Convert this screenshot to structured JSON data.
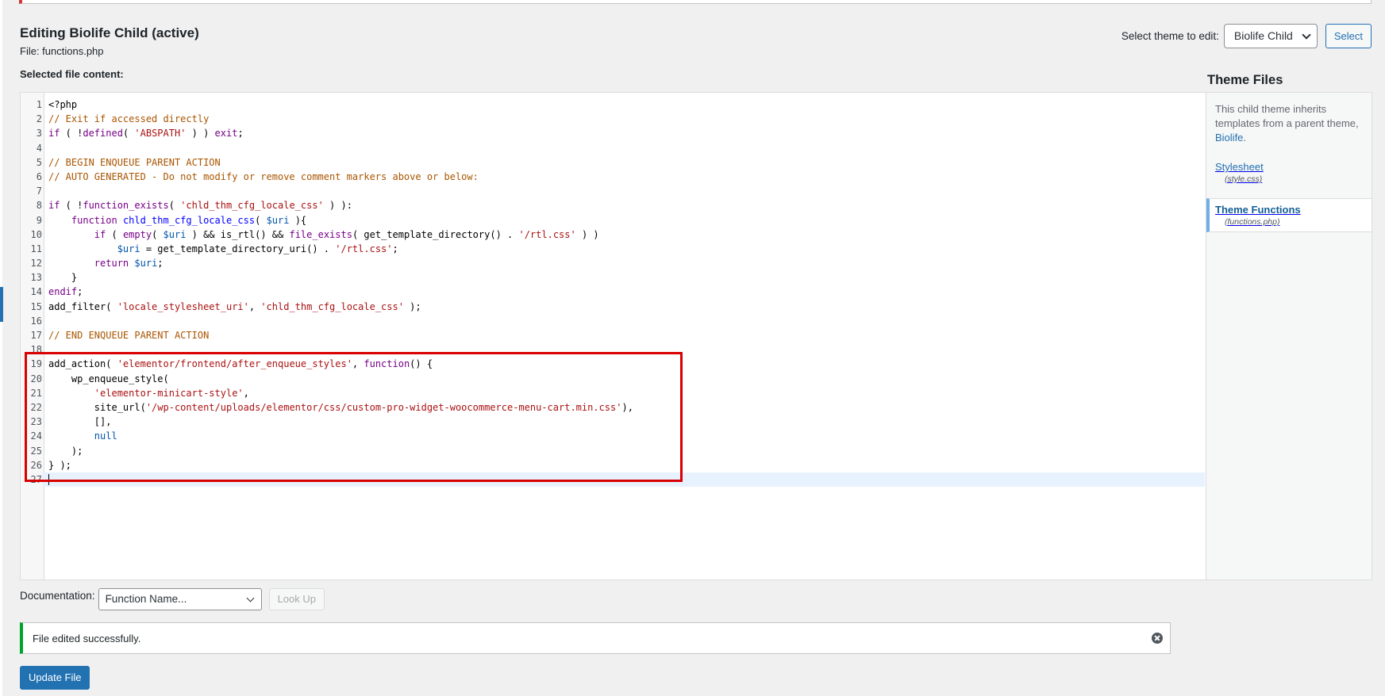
{
  "header": {
    "title": "Editing Biolife Child (active)",
    "file_prefix": "File: ",
    "file_name": "functions.php"
  },
  "theme_picker": {
    "label": "Select theme to edit:",
    "selected": "Biolife Child",
    "button_label": "Select"
  },
  "editor": {
    "content_label": "Selected file content:",
    "active_line": 27,
    "lines": [
      [
        {
          "t": "<?php",
          "c": "plain"
        }
      ],
      [
        {
          "t": "// Exit if accessed directly",
          "c": "comment"
        }
      ],
      [
        {
          "t": "if",
          "c": "kw"
        },
        {
          "t": " ( !",
          "c": "plain"
        },
        {
          "t": "defined",
          "c": "kw"
        },
        {
          "t": "( ",
          "c": "plain"
        },
        {
          "t": "'ABSPATH'",
          "c": "str"
        },
        {
          "t": " ) ) ",
          "c": "plain"
        },
        {
          "t": "exit",
          "c": "kw"
        },
        {
          "t": ";",
          "c": "plain"
        }
      ],
      [],
      [
        {
          "t": "// BEGIN ENQUEUE PARENT ACTION",
          "c": "comment"
        }
      ],
      [
        {
          "t": "// AUTO GENERATED - Do not modify or remove comment markers above or below:",
          "c": "comment"
        }
      ],
      [],
      [
        {
          "t": "if",
          "c": "kw"
        },
        {
          "t": " ( !",
          "c": "plain"
        },
        {
          "t": "function_exists",
          "c": "kw"
        },
        {
          "t": "( ",
          "c": "plain"
        },
        {
          "t": "'chld_thm_cfg_locale_css'",
          "c": "str"
        },
        {
          "t": " ) ):",
          "c": "plain"
        }
      ],
      [
        {
          "t": "    ",
          "c": "plain"
        },
        {
          "t": "function",
          "c": "kw"
        },
        {
          "t": " ",
          "c": "plain"
        },
        {
          "t": "chld_thm_cfg_locale_css",
          "c": "def"
        },
        {
          "t": "( ",
          "c": "plain"
        },
        {
          "t": "$uri",
          "c": "var"
        },
        {
          "t": " ){",
          "c": "plain"
        }
      ],
      [
        {
          "t": "        ",
          "c": "plain"
        },
        {
          "t": "if",
          "c": "kw"
        },
        {
          "t": " ( ",
          "c": "plain"
        },
        {
          "t": "empty",
          "c": "kw"
        },
        {
          "t": "( ",
          "c": "plain"
        },
        {
          "t": "$uri",
          "c": "var"
        },
        {
          "t": " ) && is_rtl() && ",
          "c": "plain"
        },
        {
          "t": "file_exists",
          "c": "kw"
        },
        {
          "t": "( get_template_directory() . ",
          "c": "plain"
        },
        {
          "t": "'/rtl.css'",
          "c": "str"
        },
        {
          "t": " ) )",
          "c": "plain"
        }
      ],
      [
        {
          "t": "            ",
          "c": "plain"
        },
        {
          "t": "$uri",
          "c": "var"
        },
        {
          "t": " = get_template_directory_uri() . ",
          "c": "plain"
        },
        {
          "t": "'/rtl.css'",
          "c": "str"
        },
        {
          "t": ";",
          "c": "plain"
        }
      ],
      [
        {
          "t": "        ",
          "c": "plain"
        },
        {
          "t": "return",
          "c": "kw"
        },
        {
          "t": " ",
          "c": "plain"
        },
        {
          "t": "$uri",
          "c": "var"
        },
        {
          "t": ";",
          "c": "plain"
        }
      ],
      [
        {
          "t": "    }",
          "c": "plain"
        }
      ],
      [
        {
          "t": "endif",
          "c": "kw"
        },
        {
          "t": ";",
          "c": "plain"
        }
      ],
      [
        {
          "t": "add_filter( ",
          "c": "plain"
        },
        {
          "t": "'locale_stylesheet_uri'",
          "c": "str"
        },
        {
          "t": ", ",
          "c": "plain"
        },
        {
          "t": "'chld_thm_cfg_locale_css'",
          "c": "str"
        },
        {
          "t": " );",
          "c": "plain"
        }
      ],
      [],
      [
        {
          "t": "// END ENQUEUE PARENT ACTION",
          "c": "comment"
        }
      ],
      [],
      [
        {
          "t": "add_action( ",
          "c": "plain"
        },
        {
          "t": "'elementor/frontend/after_enqueue_styles'",
          "c": "str"
        },
        {
          "t": ", ",
          "c": "plain"
        },
        {
          "t": "function",
          "c": "kw"
        },
        {
          "t": "() {",
          "c": "plain"
        }
      ],
      [
        {
          "t": "    wp_enqueue_style(",
          "c": "plain"
        }
      ],
      [
        {
          "t": "        ",
          "c": "plain"
        },
        {
          "t": "'elementor-minicart-style'",
          "c": "str"
        },
        {
          "t": ",",
          "c": "plain"
        }
      ],
      [
        {
          "t": "        site_url(",
          "c": "plain"
        },
        {
          "t": "'/wp-content/uploads/elementor/css/custom-pro-widget-woocommerce-menu-cart.min.css'",
          "c": "str"
        },
        {
          "t": "),",
          "c": "plain"
        }
      ],
      [
        {
          "t": "        [],",
          "c": "plain"
        }
      ],
      [
        {
          "t": "        ",
          "c": "plain"
        },
        {
          "t": "null",
          "c": "var"
        }
      ],
      [
        {
          "t": "    );",
          "c": "plain"
        }
      ],
      [
        {
          "t": "} );",
          "c": "plain"
        }
      ],
      []
    ]
  },
  "sidebar": {
    "heading": "Theme Files",
    "note_text": "This child theme inherits templates from a parent theme,",
    "parent_link": "Biolife",
    "note_end": ".",
    "files": [
      {
        "name": "Stylesheet",
        "path": "(style.css)",
        "current": false
      },
      {
        "name": "Theme Functions",
        "path": "(functions.php)",
        "current": true
      }
    ]
  },
  "documentation": {
    "label": "Documentation:",
    "select_value": "Function Name...",
    "lookup_label": "Look Up"
  },
  "notice": {
    "message": "File edited successfully."
  },
  "update_button": "Update File",
  "colors": {
    "accent": "#2271b1",
    "success": "#00a32a",
    "highlight_box": "#d80000",
    "comment": "#aa5500",
    "keyword": "#770088",
    "string": "#aa1111",
    "variable": "#0055aa"
  }
}
